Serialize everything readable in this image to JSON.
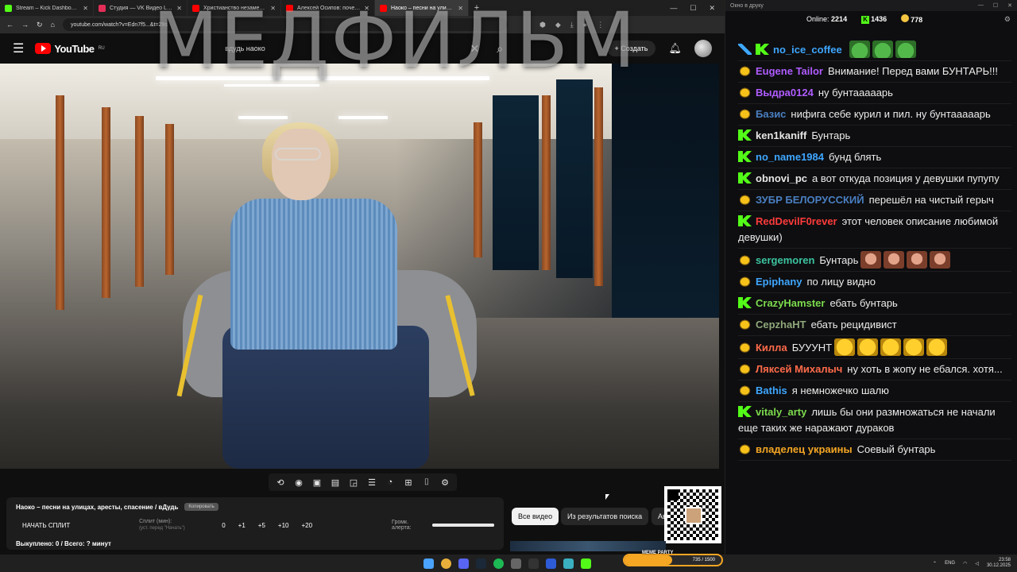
{
  "browser": {
    "tabs": [
      {
        "title": "Stream – Kick Dashboard",
        "color": "#53fc18",
        "active": false
      },
      {
        "title": "Студия — VK Видео Live",
        "color": "#e52e57",
        "active": false
      },
      {
        "title": "Христианство незаметно уходи",
        "color": "#ff0000",
        "active": false
      },
      {
        "title": "Алексей Осипов: почему Бог",
        "color": "#ff0000",
        "active": false
      },
      {
        "title": "Наоко – песни на улицах, ",
        "color": "#ff0000",
        "active": true
      }
    ],
    "url": "youtube.com/watch?v=Edn7f5...&t=29s"
  },
  "youtube": {
    "region": "RU",
    "logo_text": "YouTube",
    "search_value": "вдудь наоко",
    "create_label": "Создать"
  },
  "overlay_title": "МЕДФИЛЬМ",
  "info": {
    "video_title": "Наоко – песни на улицах, аресты, спасение / вДудь",
    "copy_label": "Копировать",
    "split_start": "НАЧАТЬ СПЛИТ",
    "split_label": "Сплит (мин):",
    "split_hint": "(уст. перед \"Начать\")",
    "split_values": [
      "0",
      "+1",
      "+5",
      "+10",
      "+20"
    ],
    "alert_label": "Громк. алерта:",
    "alert_volume": 1.0,
    "bought": "Выкуплено: 0 / Всего: ? минут"
  },
  "chips": [
    "Все видео",
    "Из результатов поиска",
    "Ав"
  ],
  "chat": {
    "window_title": "Окно в друку",
    "online_label": "Online:",
    "online": "2214",
    "kick_count": "1436",
    "coin_count": "778",
    "messages": [
      {
        "badge": "kick",
        "user": "no_ice_coffee",
        "color": "#3ea6ff",
        "text": "",
        "emotes": [
          "frog",
          "frog",
          "frog"
        ],
        "pre_badge": "sword"
      },
      {
        "badge": "pepe",
        "user": "Eugene Tailor",
        "color": "#b05cff",
        "text": "Внимание! Перед вами БУНТАРЬ!!!",
        "emotes": []
      },
      {
        "badge": "pepe",
        "user": "Выдра0124",
        "color": "#b05cff",
        "text": "ну бунтааааарь",
        "emotes": []
      },
      {
        "badge": "pepe",
        "user": "Базис",
        "color": "#4a7fc1",
        "text": "нифига себе курил и пил. ну бунтааааарь",
        "emotes": []
      },
      {
        "badge": "kick",
        "user": "ken1kaniff",
        "color": "#e6e6e6",
        "text": "Бунтарь",
        "emotes": []
      },
      {
        "badge": "kick",
        "user": "no_name1984",
        "color": "#3ea6ff",
        "text": "бунд блять",
        "emotes": []
      },
      {
        "badge": "kick",
        "user": "obnovi_pc",
        "color": "#e6e6e6",
        "text": "а вот откуда позиция у девушки пупупу",
        "emotes": []
      },
      {
        "badge": "pepe",
        "user": "ЗУБР БЕЛОРУССКИЙ",
        "color": "#4a7fc1",
        "text": "перешёл на чистый герыч",
        "emotes": []
      },
      {
        "badge": "kick",
        "user": "RedDevilF0rever",
        "color": "#ff3b3b",
        "text": "этот человек описание любимой девушки)",
        "emotes": []
      },
      {
        "badge": "pepe",
        "user": "sergemoren",
        "color": "#3cc4a0",
        "text": "Бунтарь",
        "emotes": [
          "face",
          "face",
          "face",
          "face"
        ]
      },
      {
        "badge": "pepe",
        "user": "Epiphany",
        "color": "#3ea6ff",
        "text": "по лицу видно",
        "emotes": []
      },
      {
        "badge": "kick",
        "user": "CrazyHamster",
        "color": "#7cdb4d",
        "text": "ебать бунтарь",
        "emotes": []
      },
      {
        "badge": "pepe",
        "user": "СерzhаНТ",
        "color": "#8fa87a",
        "text": "ебать рецидивист",
        "emotes": []
      },
      {
        "badge": "pepe",
        "user": "Килла",
        "color": "#ff6b4a",
        "text": "БУУУНТ",
        "emotes": [
          "laugh",
          "laugh",
          "laugh",
          "laugh",
          "laugh"
        ]
      },
      {
        "badge": "pepe",
        "user": "Ляксей Михалыч",
        "color": "#ff6b4a",
        "text": "ну хоть в жопу не ебался. хотя...",
        "emotes": []
      },
      {
        "badge": "pepe",
        "user": "Bathis",
        "color": "#3ea6ff",
        "text": "я немножечко шалю",
        "emotes": []
      },
      {
        "badge": "kick",
        "user": "vitaly_arty",
        "color": "#7cdb4d",
        "text": "лишь бы они размножаться не начали еще таких же наражают дураков",
        "emotes": []
      },
      {
        "badge": "pepe",
        "user": "владелец украины",
        "color": "#f5a623",
        "text": "Соевый бунтарь",
        "emotes": []
      }
    ]
  },
  "meme_party": {
    "label": "MEME PARTY",
    "progress_text": "735 / 1500",
    "progress": 0.49
  },
  "taskbar": {
    "lang": "ENG",
    "time": "23:58",
    "date": "30.12.2025"
  }
}
